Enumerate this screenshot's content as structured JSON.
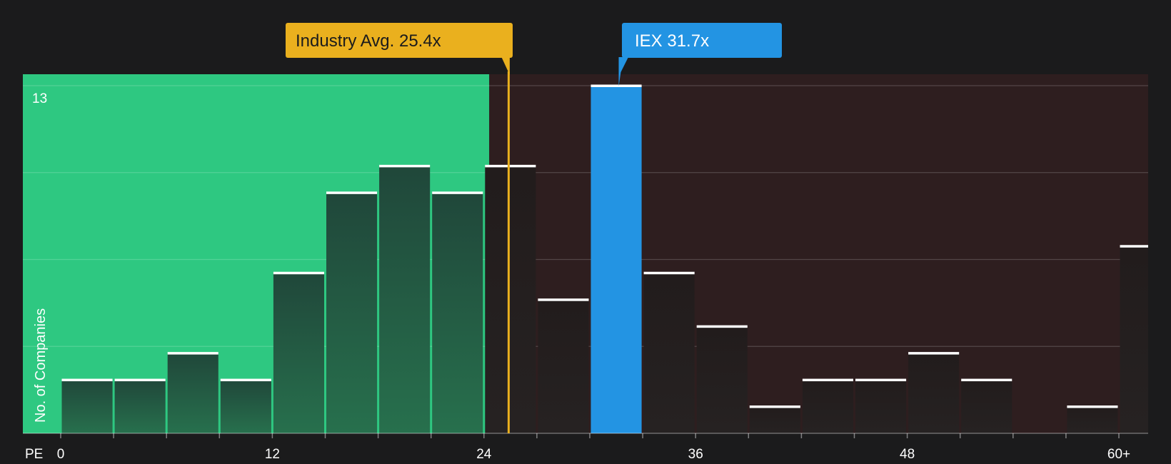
{
  "chart_data": {
    "type": "bar",
    "xlabel": "PE",
    "ylabel": "No. of Companies",
    "ymax_label": "13",
    "ylim": [
      0,
      13
    ],
    "bin_width": 3,
    "x_ticks": [
      "0",
      "12",
      "24",
      "36",
      "48",
      "60+"
    ],
    "x_tick_values": [
      0,
      12,
      24,
      36,
      48,
      60
    ],
    "bins": [
      {
        "start": 0,
        "value": 2
      },
      {
        "start": 3,
        "value": 2
      },
      {
        "start": 6,
        "value": 3
      },
      {
        "start": 9,
        "value": 2
      },
      {
        "start": 12,
        "value": 6
      },
      {
        "start": 15,
        "value": 9
      },
      {
        "start": 18,
        "value": 10
      },
      {
        "start": 21,
        "value": 9
      },
      {
        "start": 24,
        "value": 10
      },
      {
        "start": 27,
        "value": 5
      },
      {
        "start": 30,
        "value": 13,
        "highlight": true
      },
      {
        "start": 33,
        "value": 6
      },
      {
        "start": 36,
        "value": 4
      },
      {
        "start": 39,
        "value": 1
      },
      {
        "start": 42,
        "value": 2
      },
      {
        "start": 45,
        "value": 2
      },
      {
        "start": 48,
        "value": 3
      },
      {
        "start": 51,
        "value": 2
      },
      {
        "start": 54,
        "value": 0
      },
      {
        "start": 57,
        "value": 1
      },
      {
        "start": 60,
        "value": 7
      }
    ],
    "industry_avg": {
      "label": "Industry Avg. 25.4x",
      "value": 25.4
    },
    "company": {
      "label": "IEX 31.7x",
      "value": 31.7
    },
    "colors": {
      "background": "#1b1b1c",
      "below_region": "#2ec881",
      "above_region": "#2e1e1f",
      "industry": "#eab01e",
      "company": "#2394e3",
      "bar_cap": "#ffffff"
    }
  }
}
